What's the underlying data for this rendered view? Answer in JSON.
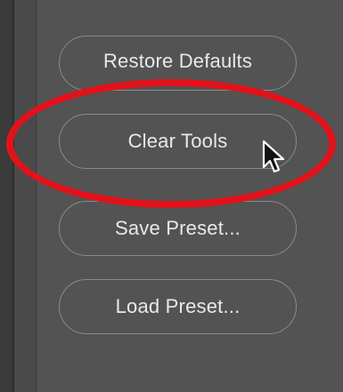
{
  "panel": {
    "buttons": [
      {
        "label": "Restore Defaults"
      },
      {
        "label": "Clear Tools"
      },
      {
        "label": "Save Preset..."
      },
      {
        "label": "Load Preset..."
      }
    ]
  },
  "colors": {
    "background": "#535353",
    "button_text": "#e9e9e9",
    "button_border": "#8a8a8a",
    "highlight_ring": "#e2121b"
  },
  "icons": {
    "cursor": "arrow-pointer-icon"
  }
}
